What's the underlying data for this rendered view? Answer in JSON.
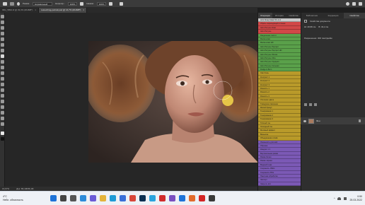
{
  "options_bar": {
    "mode_label": "Режим:",
    "mode_value": "Нормальный",
    "opacity_label": "Непрозр.:",
    "opacity_value": "100%",
    "flow_label": "Нажим:",
    "flow_value": "100%"
  },
  "tabs": [
    {
      "label": "IMG_5894.tif @ 33,3% (RGB/8*)",
      "close": "×",
      "active": false
    },
    {
      "label": "retouching-portrait.psd @ 16,7% (RGB/8*)",
      "close": "×",
      "active": true
    }
  ],
  "status": {
    "zoom": "16,67%",
    "doc": "Док: 86,1M/86,1M"
  },
  "panels": {
    "actions_tabs": [
      "Операции",
      "История",
      "Свойства"
    ],
    "props_tabs": [
      "Библиотеки",
      "Коррекция",
      "Свойства"
    ],
    "props_title": "Свойства документа",
    "props_w": "Ш: 48,86 см",
    "props_h": "В: 34,2 см",
    "props_res": "Разрешение: 300 пикс/дюйм",
    "layer_name": "Фон"
  },
  "actions": [
    {
      "label": "HLS Sharp Mask 5K v2.4",
      "color": "#c8c8c8"
    },
    {
      "label": "Убрать переходящий оттенок",
      "color": "#d14848"
    },
    {
      "label": "Авто Ретушь Кожи",
      "color": "#d14848"
    },
    {
      "label": "Авто Ретушь",
      "color": "#d14848"
    },
    {
      "label": "Разделение частот",
      "color": "#5aa04a"
    },
    {
      "label": "Маска кожи",
      "color": "#5aa04a"
    },
    {
      "label": "Маска кожи HD",
      "color": "#5aa04a"
    },
    {
      "label": "Авто Ретушь Портрет",
      "color": "#5aa04a"
    },
    {
      "label": "Авто Ретушь Портрет HD",
      "color": "#5aa04a"
    },
    {
      "label": "Авто Ретушь Лёгкая",
      "color": "#5aa04a"
    },
    {
      "label": "Авто Ретушь Ultra",
      "color": "#5aa04a"
    },
    {
      "label": "Авто Ретушь Средняя",
      "color": "#5aa04a"
    },
    {
      "label": "Авто Ретушь Сильная",
      "color": "#5aa04a"
    },
    {
      "label": "Dodge & Burn",
      "color": "#5aa04a"
    },
    {
      "label": "Свет/тень",
      "color": "#b99a2a"
    },
    {
      "label": "Контраст 1",
      "color": "#b99a2a"
    },
    {
      "label": "Контраст 2",
      "color": "#b99a2a"
    },
    {
      "label": "Контраст 3",
      "color": "#b99a2a"
    },
    {
      "label": "Резкость 1",
      "color": "#b99a2a"
    },
    {
      "label": "Резкость 2",
      "color": "#b99a2a"
    },
    {
      "label": "Резкость 3",
      "color": "#b99a2a"
    },
    {
      "label": "Усиление цвета",
      "color": "#b99a2a"
    },
    {
      "label": "Гламурное свечение",
      "color": "#b99a2a"
    },
    {
      "label": "Мягкий фокус",
      "color": "#b99a2a"
    },
    {
      "label": "Тонирование 1",
      "color": "#b99a2a"
    },
    {
      "label": "Тонирование 2",
      "color": "#b99a2a"
    },
    {
      "label": "Тонирование 3",
      "color": "#b99a2a"
    },
    {
      "label": "Тёплый тон",
      "color": "#b99a2a"
    },
    {
      "label": "Холодный тон",
      "color": "#b99a2a"
    },
    {
      "label": "Матовый эффект",
      "color": "#b99a2a"
    },
    {
      "label": "Виньетка",
      "color": "#b99a2a"
    },
    {
      "label": "Объединение слоёв",
      "color": "#b99a2a"
    },
    {
      "label": "Уменьшить для web",
      "color": "#7b59b5"
    },
    {
      "label": "Обрезка",
      "color": "#7b59b5"
    },
    {
      "label": "Квадрат 1:1",
      "color": "#7b59b5"
    },
    {
      "label": "Вертикальная рамка",
      "color": "#7b59b5"
    },
    {
      "label": "Рамка белая",
      "color": "#7b59b5"
    },
    {
      "label": "Рамка чёрная",
      "color": "#7b59b5"
    },
    {
      "label": "Водяной знак",
      "color": "#7b59b5"
    },
    {
      "label": "Сохранить JPEG",
      "color": "#7b59b5"
    },
    {
      "label": "Сохранить PNG",
      "color": "#7b59b5"
    },
    {
      "label": "Пакетная обработка",
      "color": "#7b59b5"
    },
    {
      "label": "Экспорт",
      "color": "#7b59b5"
    },
    {
      "label": "Закрыть всё",
      "color": "#7b59b5"
    }
  ],
  "taskbar": {
    "weather_temp": "4°C",
    "weather_desc": "Небл. облачность",
    "time": "0:50",
    "date": "25.03.2022",
    "icons": [
      {
        "name": "windows-icon",
        "color": "#1e73d8"
      },
      {
        "name": "search-icon",
        "color": "#444444"
      },
      {
        "name": "task-view-icon",
        "color": "#555555"
      },
      {
        "name": "widgets-icon",
        "color": "#2d8bd9"
      },
      {
        "name": "chat-icon",
        "color": "#6b5bd6"
      },
      {
        "name": "explorer-icon",
        "color": "#e4b33a"
      },
      {
        "name": "edge-icon",
        "color": "#1f9bd6"
      },
      {
        "name": "store-icon",
        "color": "#3a6fd8"
      },
      {
        "name": "chrome-icon",
        "color": "#d8463a"
      },
      {
        "name": "photoshop-icon",
        "color": "#0b2f52"
      },
      {
        "name": "telegram-icon",
        "color": "#2aa3dd"
      },
      {
        "name": "opera-icon",
        "color": "#d12b2b"
      },
      {
        "name": "viber-icon",
        "color": "#7a4fc0"
      },
      {
        "name": "mail-icon",
        "color": "#1e73d8"
      },
      {
        "name": "media-icon",
        "color": "#e36b2c"
      },
      {
        "name": "yandex-icon",
        "color": "#d32525"
      },
      {
        "name": "bridge-icon",
        "color": "#3a3a3a"
      }
    ]
  }
}
